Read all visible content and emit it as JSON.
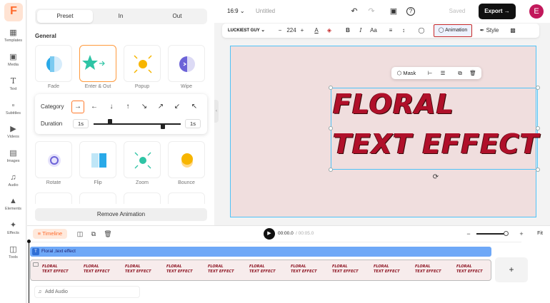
{
  "sidebar": {
    "logo": "F",
    "items": [
      {
        "label": "Templates",
        "icon": "grid-icon"
      },
      {
        "label": "Media",
        "icon": "media-icon"
      },
      {
        "label": "Text",
        "icon": "text-icon"
      },
      {
        "label": "Subtitles",
        "icon": "subtitles-icon"
      },
      {
        "label": "Videos",
        "icon": "video-icon"
      },
      {
        "label": "Images",
        "icon": "image-icon"
      },
      {
        "label": "Audio",
        "icon": "music-icon"
      },
      {
        "label": "Elements",
        "icon": "elements-icon"
      },
      {
        "label": "Effects",
        "icon": "effects-icon"
      },
      {
        "label": "Tools",
        "icon": "tools-icon"
      }
    ]
  },
  "panel": {
    "tabs": [
      "Preset",
      "In",
      "Out"
    ],
    "active_tab": "Preset",
    "section_title": "General",
    "animations_row1": [
      "Fade",
      "Enter & Out",
      "Popup",
      "Wipe"
    ],
    "animations_row2": [
      "Rotate",
      "Flip",
      "Zoom",
      "Bounce"
    ],
    "selected_animation": "Enter & Out",
    "options": {
      "category_label": "Category",
      "directions": [
        "→",
        "←",
        "↓",
        "↑",
        "↘",
        "↗",
        "↙",
        "↖"
      ],
      "duration_label": "Duration",
      "duration_min": "1s",
      "duration_max": "1s"
    },
    "remove_label": "Remove Animation"
  },
  "topbar": {
    "ratio": "16:9",
    "title": "Untitled",
    "saved": "Saved",
    "export": "Export",
    "avatar": "E"
  },
  "toolbar": {
    "font": "LUCKIEST GUY",
    "font_size": "224",
    "animation": "Animation",
    "style": "Style"
  },
  "floatbar": {
    "mask": "Mask"
  },
  "canvas": {
    "line1": "FLORAL",
    "line2": "TEXT EFFECT",
    "background_color": "#f0dede",
    "text_color": "#b0102a"
  },
  "timeline": {
    "chip": "Timeline",
    "current_time": "00:00.0",
    "total_time": "/ 00:05.0",
    "fit": "Fit",
    "text_track_label": "Floral ,text effect",
    "frame_line1": "FLORAL",
    "frame_line2": "TEXT EFFECT",
    "add_audio": "Add Audio"
  }
}
